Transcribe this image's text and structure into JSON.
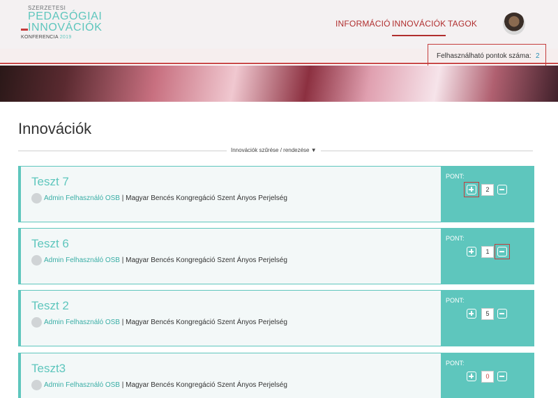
{
  "logo": {
    "line1": "SZERZETESI",
    "line2": "PEDAGÓGIAI",
    "line3": "INNOVÁCIÓK",
    "line4_word": "KONFERENCIA",
    "line4_year": "2019"
  },
  "nav": {
    "items": [
      {
        "label": "INFORMÁCIÓ",
        "active": false
      },
      {
        "label": "INNOVÁCIÓK",
        "active": true
      },
      {
        "label": "TAGOK",
        "active": false
      }
    ]
  },
  "points": {
    "label": "Felhasználható pontok száma:",
    "value": "2"
  },
  "page": {
    "title": "Innovációk",
    "filter_label": "Innovációk szűrése / rendezése ▼"
  },
  "cards": [
    {
      "title": "Teszt 7",
      "author": "Admin Felhasználó OSB",
      "org": " | Magyar Bencés Kongregáció Szent Ányos Perjelség",
      "points_label": "PONT:",
      "points": "2"
    },
    {
      "title": "Teszt 6",
      "author": "Admin Felhasználó OSB",
      "org": " | Magyar Bencés Kongregáció Szent Ányos Perjelség",
      "points_label": "PONT:",
      "points": "1"
    },
    {
      "title": "Teszt 2",
      "author": "Admin Felhasználó OSB",
      "org": " | Magyar Bencés Kongregáció Szent Ányos Perjelség",
      "points_label": "PONT:",
      "points": "5"
    },
    {
      "title": "Teszt3",
      "author": "Admin Felhasználó OSB",
      "org": " | Magyar Bencés Kongregáció Szent Ányos Perjelség",
      "points_label": "PONT:",
      "points": "0"
    }
  ],
  "colors": {
    "accent": "#5ec6bd",
    "nav_red": "#b02e2e",
    "highlight_red": "#c43c3c"
  },
  "icons": {
    "increment": "plus-square-icon",
    "decrement": "minus-square-icon",
    "author_avatar": "user-avatar-icon"
  }
}
